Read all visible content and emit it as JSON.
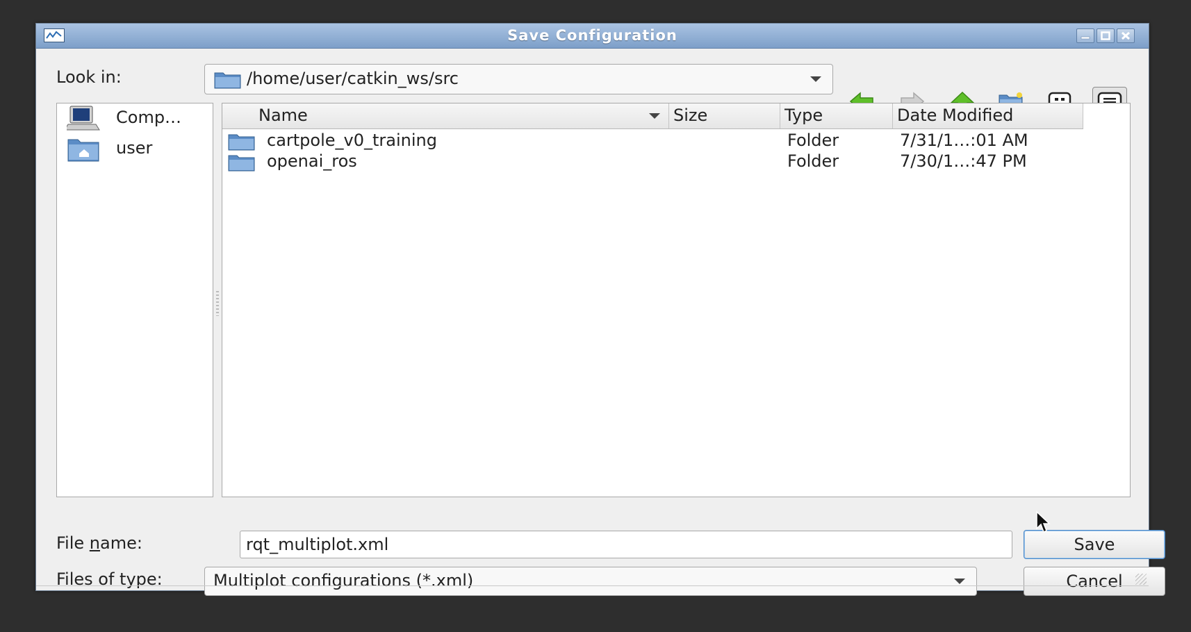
{
  "window": {
    "title": "Save Configuration"
  },
  "toolbar": {
    "look_in_label": "Look in:",
    "path": "/home/user/catkin_ws/src"
  },
  "sidebar": {
    "items": [
      {
        "label": "Comp…",
        "icon": "computer-icon"
      },
      {
        "label": "user",
        "icon": "home-folder-icon"
      }
    ]
  },
  "filelist": {
    "columns": [
      "Name",
      "Size",
      "Type",
      "Date Modified"
    ],
    "rows": [
      {
        "name": "cartpole_v0_training",
        "size": "",
        "type": "Folder",
        "modified": "7/31/1…:01 AM"
      },
      {
        "name": "openai_ros",
        "size": "",
        "type": "Folder",
        "modified": "7/30/1…:47 PM"
      }
    ]
  },
  "filename": {
    "label_pre": "File ",
    "label_accel": "n",
    "label_post": "ame:",
    "value": "rqt_multiplot.xml"
  },
  "filetype": {
    "label": "Files of type:",
    "value": "Multiplot configurations (*.xml)"
  },
  "buttons": {
    "save": "Save",
    "cancel": "Cancel"
  },
  "colors": {
    "titlebar": "#7d9fc9",
    "accent_green": "#5fbf2a",
    "folder_blue": "#5b8cc6"
  }
}
